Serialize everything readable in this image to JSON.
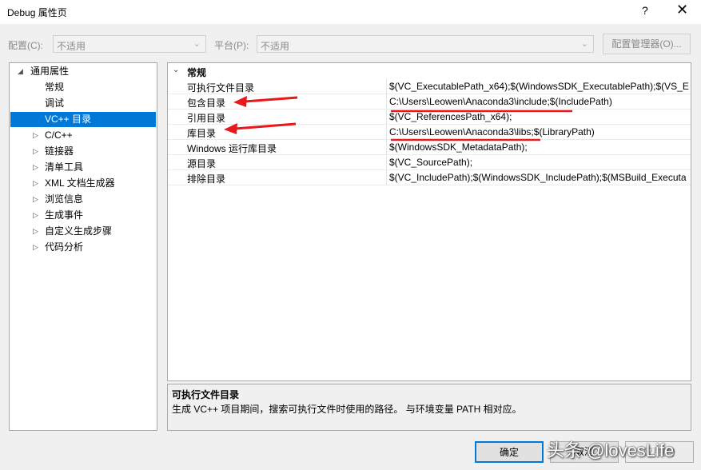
{
  "window": {
    "title": "Debug 属性页",
    "help_label": "?",
    "close_label": "✕"
  },
  "toolbar": {
    "config_label": "配置(C):",
    "config_value": "不适用",
    "platform_label": "平台(P):",
    "platform_value": "不适用",
    "config_manager_label": "配置管理器(O)..."
  },
  "tree": {
    "root_label": "通用属性",
    "items": [
      {
        "label": "常规"
      },
      {
        "label": "调试"
      },
      {
        "label": "VC++ 目录"
      },
      {
        "label": "C/C++"
      },
      {
        "label": "链接器"
      },
      {
        "label": "清单工具"
      },
      {
        "label": "XML 文档生成器"
      },
      {
        "label": "浏览信息"
      },
      {
        "label": "生成事件"
      },
      {
        "label": "自定义生成步骤"
      },
      {
        "label": "代码分析"
      }
    ]
  },
  "grid": {
    "category": "常规",
    "rows": [
      {
        "name": "可执行文件目录",
        "value": "$(VC_ExecutablePath_x64);$(WindowsSDK_ExecutablePath);$(VS_E"
      },
      {
        "name": "包含目录",
        "value": "C:\\Users\\Leowen\\Anaconda3\\include;$(IncludePath)"
      },
      {
        "name": "引用目录",
        "value": "$(VC_ReferencesPath_x64);"
      },
      {
        "name": "库目录",
        "value": "C:\\Users\\Leowen\\Anaconda3\\libs;$(LibraryPath)"
      },
      {
        "name": "Windows 运行库目录",
        "value": "$(WindowsSDK_MetadataPath);"
      },
      {
        "name": "源目录",
        "value": "$(VC_SourcePath);"
      },
      {
        "name": "排除目录",
        "value": "$(VC_IncludePath);$(WindowsSDK_IncludePath);$(MSBuild_Executa"
      }
    ]
  },
  "description": {
    "title": "可执行文件目录",
    "text": "生成 VC++ 项目期间，搜索可执行文件时使用的路径。 与环境变量 PATH 相对应。"
  },
  "buttons": {
    "ok_label": "确定",
    "cancel_label": "取消",
    "apply_label": "应用(A)"
  },
  "watermark": "头条 @lovesLife",
  "colors": {
    "selection": "#0078d7",
    "annotation": "#e8191b"
  }
}
